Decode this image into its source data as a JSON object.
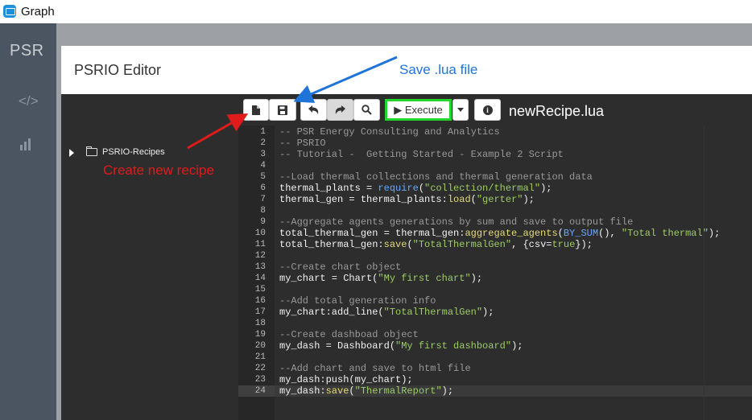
{
  "window": {
    "title": "Graph"
  },
  "sidebar": {
    "brand": "PSR",
    "items": [
      {
        "icon": "code-icon"
      },
      {
        "icon": "bar-chart-icon"
      }
    ]
  },
  "modal": {
    "title": "PSRIO Editor"
  },
  "tree": {
    "items": [
      {
        "label": "PSRIO-Recipes",
        "icon": "folder-icon",
        "expanded": false
      }
    ]
  },
  "toolbar": {
    "new_icon": "new-file-icon",
    "save_icon": "save-icon",
    "undo_icon": "undo-icon",
    "redo_icon": "redo-icon",
    "search_icon": "search-icon",
    "execute_label": "▶ Execute",
    "dropdown_icon": "caret-down-icon",
    "info_icon": "info-icon"
  },
  "file_name": "newRecipe.lua",
  "annotations": {
    "save": "Save .lua file",
    "new": "Create new recipe"
  },
  "colors": {
    "annotation_blue": "#1f74d9",
    "annotation_red": "#e01b1b",
    "highlight_green": "#22d62a"
  },
  "editor": {
    "active_line": 24,
    "lines": [
      {
        "n": "1",
        "tokens": [
          [
            "cm",
            "-- PSR Energy Consulting and Analytics"
          ]
        ]
      },
      {
        "n": "2",
        "tokens": [
          [
            "cm",
            "-- PSRIO"
          ]
        ]
      },
      {
        "n": "3",
        "tokens": [
          [
            "cm",
            "-- Tutorial -  Getting Started - Example 2 Script"
          ]
        ]
      },
      {
        "n": "4",
        "tokens": []
      },
      {
        "n": "5",
        "tokens": [
          [
            "cm",
            "--Load thermal collections and thermal generation data"
          ]
        ]
      },
      {
        "n": "6",
        "tokens": [
          [
            "tx",
            "thermal_plants = "
          ],
          [
            "bl",
            "require"
          ],
          [
            "tx",
            "("
          ],
          [
            "st",
            "\"collection/thermal\""
          ],
          [
            "tx",
            ");"
          ]
        ]
      },
      {
        "n": "7",
        "tokens": [
          [
            "tx",
            "thermal_gen = thermal_plants:"
          ],
          [
            "fn",
            "load"
          ],
          [
            "tx",
            "("
          ],
          [
            "st",
            "\"gerter\""
          ],
          [
            "tx",
            ");"
          ]
        ]
      },
      {
        "n": "8",
        "tokens": []
      },
      {
        "n": "9",
        "tokens": [
          [
            "cm",
            "--Aggregate agents generations by sum and save to output file"
          ]
        ]
      },
      {
        "n": "10",
        "tokens": [
          [
            "tx",
            "total_thermal_gen = thermal_gen:"
          ],
          [
            "fn",
            "aggregate_agents"
          ],
          [
            "tx",
            "("
          ],
          [
            "bl",
            "BY_SUM"
          ],
          [
            "tx",
            "(), "
          ],
          [
            "st",
            "\"Total thermal\""
          ],
          [
            "tx",
            ");"
          ]
        ]
      },
      {
        "n": "11",
        "tokens": [
          [
            "tx",
            "total_thermal_gen:"
          ],
          [
            "fn",
            "save"
          ],
          [
            "tx",
            "("
          ],
          [
            "st",
            "\"TotalThermalGen\""
          ],
          [
            "tx",
            ", {csv="
          ],
          [
            "st",
            "true"
          ],
          [
            "tx",
            "});"
          ]
        ]
      },
      {
        "n": "12",
        "tokens": []
      },
      {
        "n": "13",
        "tokens": [
          [
            "cm",
            "--Create chart object"
          ]
        ]
      },
      {
        "n": "14",
        "tokens": [
          [
            "tx",
            "my_chart = Chart("
          ],
          [
            "st",
            "\"My first chart\""
          ],
          [
            "tx",
            ");"
          ]
        ]
      },
      {
        "n": "15",
        "tokens": []
      },
      {
        "n": "16",
        "tokens": [
          [
            "cm",
            "--Add total generation info"
          ]
        ]
      },
      {
        "n": "17",
        "tokens": [
          [
            "tx",
            "my_chart:add_line("
          ],
          [
            "st",
            "\"TotalThermalGen\""
          ],
          [
            "tx",
            ");"
          ]
        ]
      },
      {
        "n": "18",
        "tokens": []
      },
      {
        "n": "19",
        "tokens": [
          [
            "cm",
            "--Create dashboad object"
          ]
        ]
      },
      {
        "n": "20",
        "tokens": [
          [
            "tx",
            "my_dash = Dashboard("
          ],
          [
            "st",
            "\"My first dashboard\""
          ],
          [
            "tx",
            ");"
          ]
        ]
      },
      {
        "n": "21",
        "tokens": []
      },
      {
        "n": "22",
        "tokens": [
          [
            "cm",
            "--Add chart and save to html file"
          ]
        ]
      },
      {
        "n": "23",
        "tokens": [
          [
            "tx",
            "my_dash:push(my_chart);"
          ]
        ]
      },
      {
        "n": "24",
        "tokens": [
          [
            "tx",
            "my_dash:"
          ],
          [
            "fn",
            "save"
          ],
          [
            "tx",
            "("
          ],
          [
            "st",
            "\"ThermalReport\""
          ],
          [
            "tx",
            ");"
          ]
        ]
      }
    ]
  }
}
